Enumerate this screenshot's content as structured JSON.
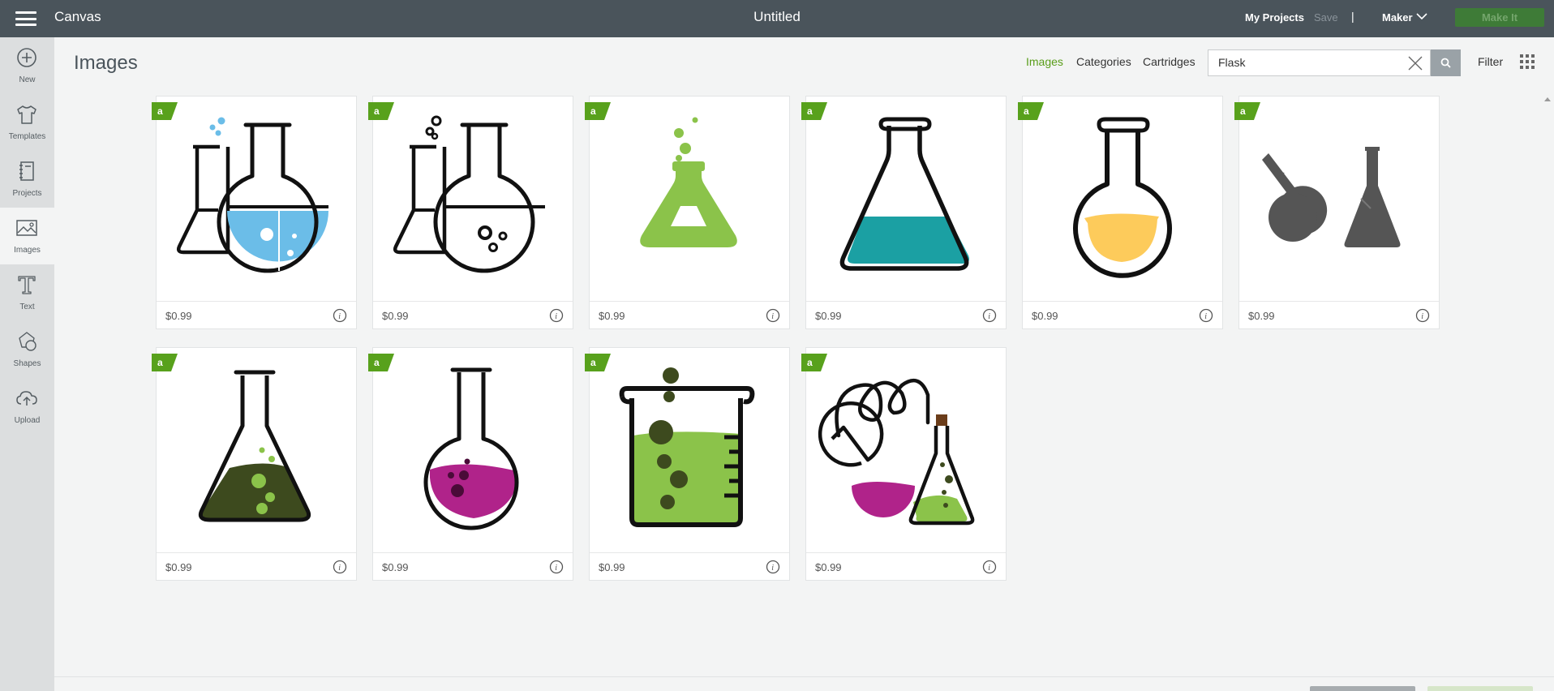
{
  "topbar": {
    "app_title": "Canvas",
    "document_title": "Untitled",
    "my_projects": "My Projects",
    "save": "Save",
    "separator": "|",
    "machine": "Maker",
    "make_it": "Make It"
  },
  "sidebar": {
    "items": [
      {
        "label": "New",
        "icon": "plus-circle-icon"
      },
      {
        "label": "Templates",
        "icon": "shirt-icon"
      },
      {
        "label": "Projects",
        "icon": "notebook-icon"
      },
      {
        "label": "Images",
        "icon": "image-icon"
      },
      {
        "label": "Text",
        "icon": "text-t-icon"
      },
      {
        "label": "Shapes",
        "icon": "shapes-icon"
      },
      {
        "label": "Upload",
        "icon": "cloud-upload-icon"
      }
    ],
    "active": "Images"
  },
  "main": {
    "heading": "Images",
    "tabs": [
      "Images",
      "Categories",
      "Cartridges"
    ],
    "active_tab": "Images",
    "search_value": "Flask",
    "filter_label": "Filter",
    "accent_color": "#5a9d1a"
  },
  "results": [
    {
      "price": "$0.99",
      "art": "flask-pair-blue"
    },
    {
      "price": "$0.99",
      "art": "flask-pair-bubbles"
    },
    {
      "price": "$0.99",
      "art": "erlenmeyer-green"
    },
    {
      "price": "$0.99",
      "art": "erlenmeyer-teal"
    },
    {
      "price": "$0.99",
      "art": "round-flask-yellow"
    },
    {
      "price": "$0.99",
      "art": "flask-silhouettes"
    },
    {
      "price": "$0.99",
      "art": "erlenmeyer-olive"
    },
    {
      "price": "$0.99",
      "art": "round-flask-magenta"
    },
    {
      "price": "$0.99",
      "art": "beaker-lime"
    },
    {
      "price": "$0.99",
      "art": "distillation-set"
    }
  ]
}
